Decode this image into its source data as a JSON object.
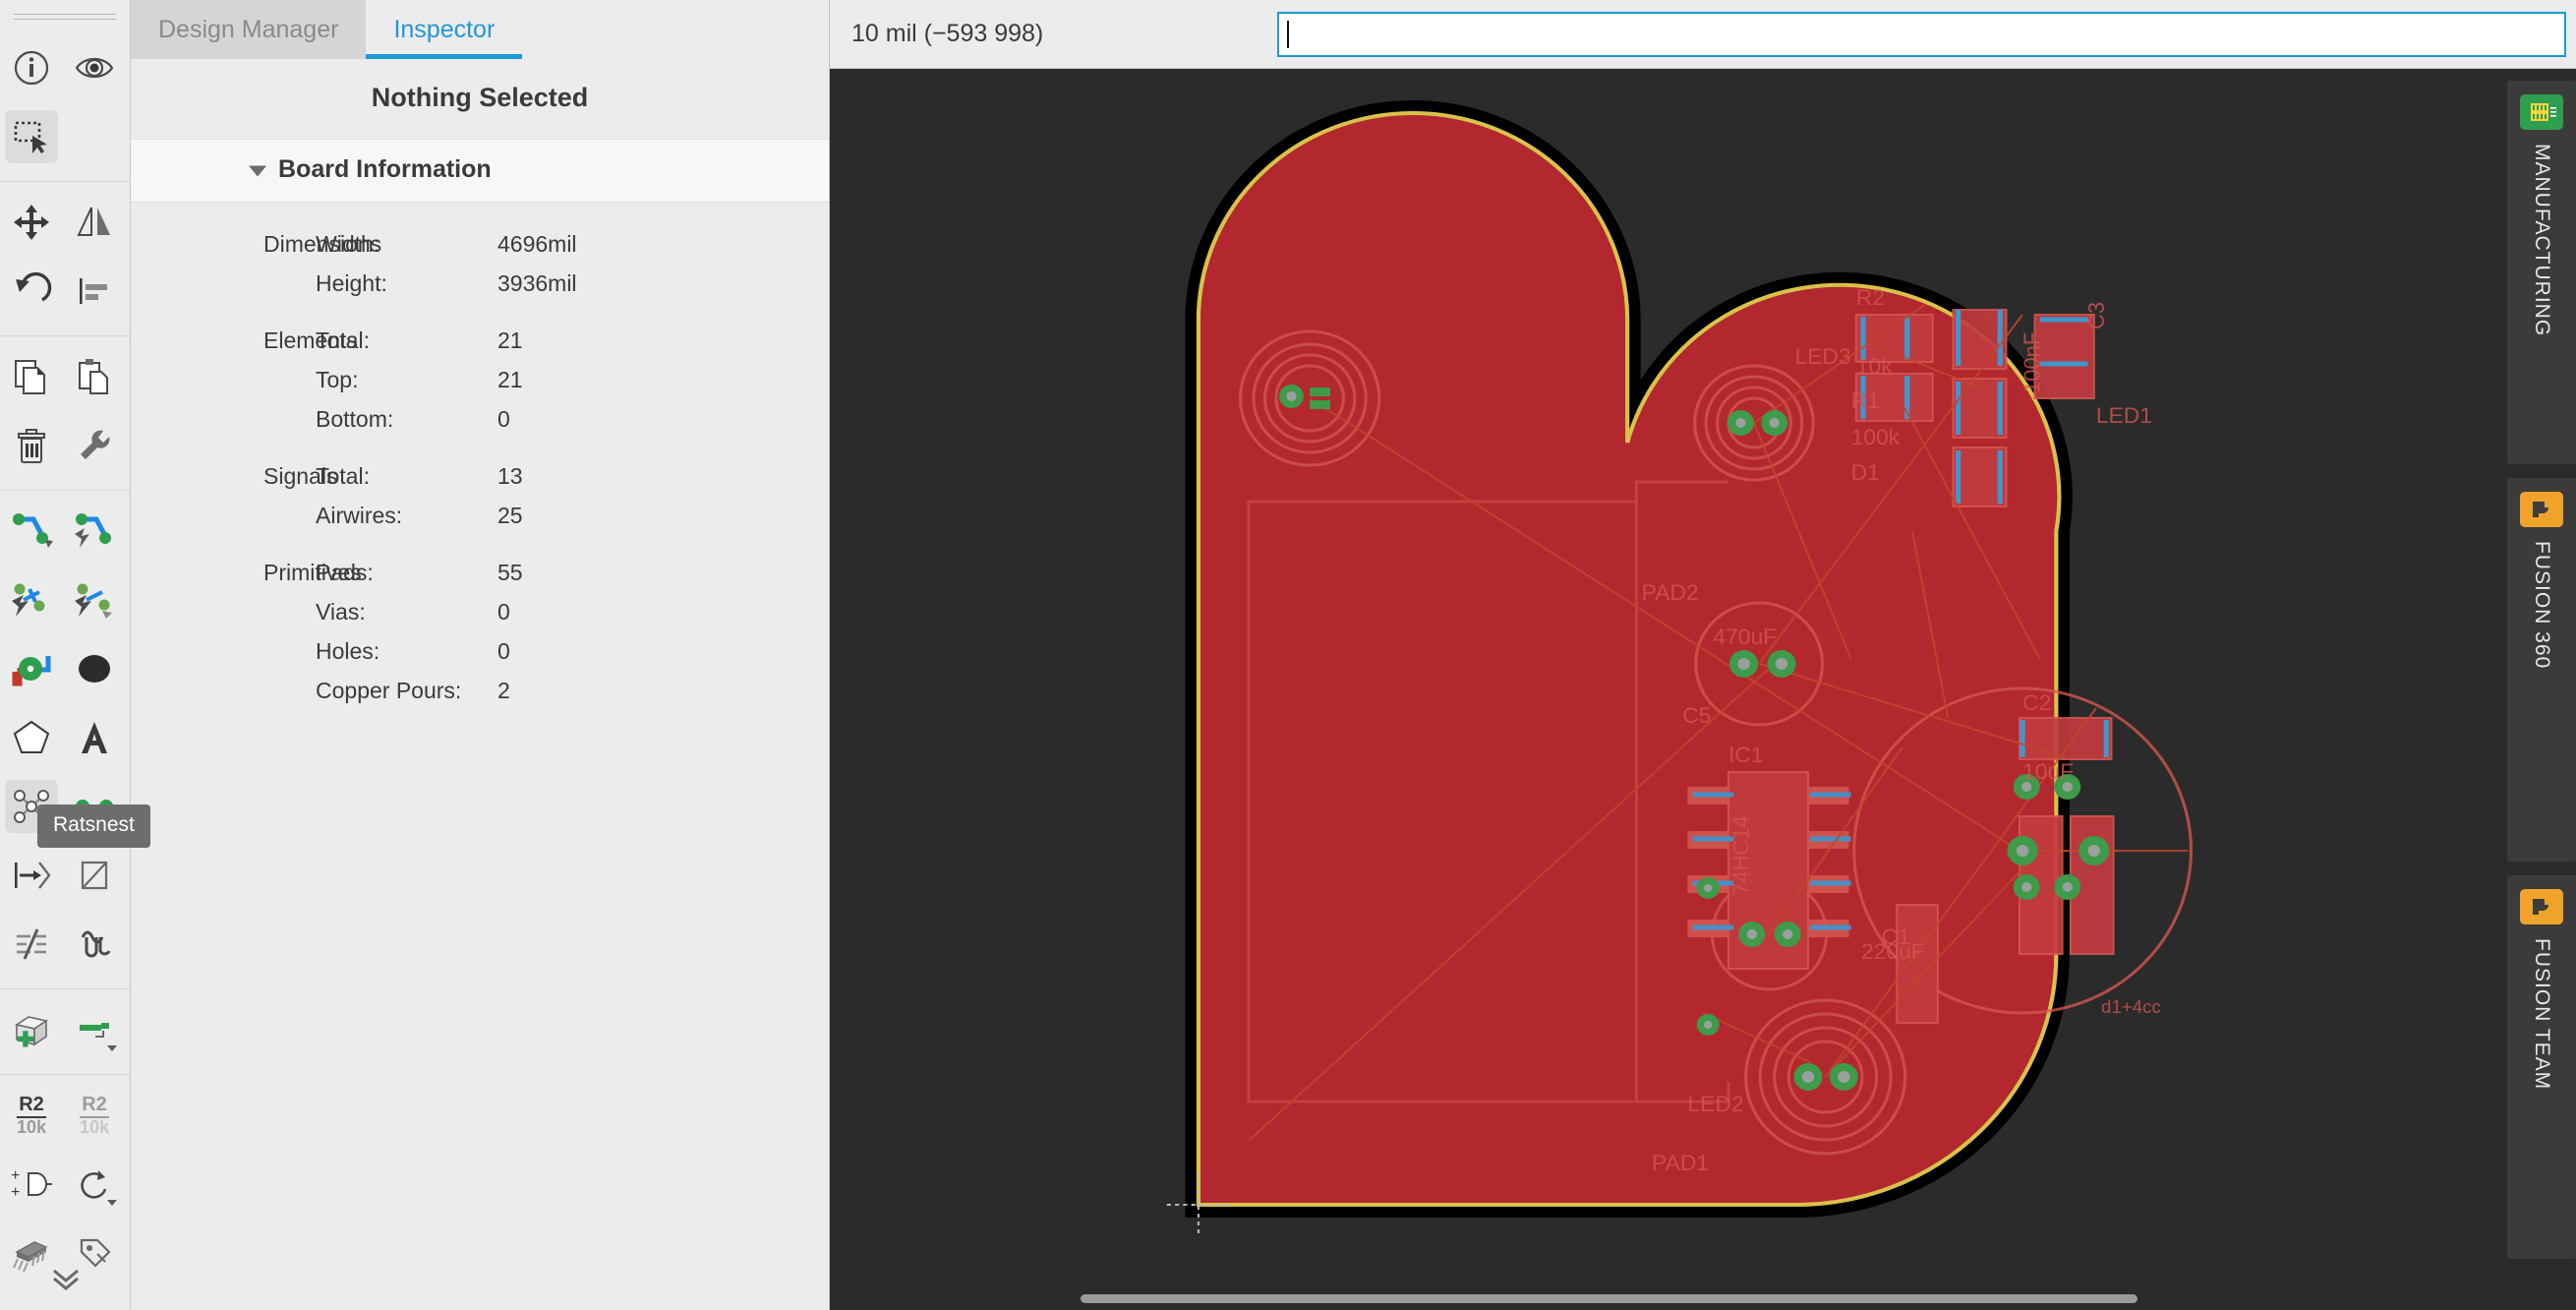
{
  "toolbar": {
    "groups": [
      {
        "items": [
          {
            "name": "info-icon",
            "label": "Info"
          },
          {
            "name": "visibility-eye-icon",
            "label": "Display Layers"
          }
        ]
      },
      {
        "items": [
          {
            "name": "select-marquee-icon",
            "label": "Select",
            "selected": true
          }
        ]
      },
      {
        "items": [
          {
            "name": "move-icon",
            "label": "Move"
          },
          {
            "name": "mirror-icon",
            "label": "Mirror"
          },
          {
            "name": "rotate-icon",
            "label": "Rotate"
          },
          {
            "name": "align-icon",
            "label": "Align"
          }
        ]
      },
      {
        "items": [
          {
            "name": "copy-icon",
            "label": "Copy"
          },
          {
            "name": "paste-icon",
            "label": "Paste"
          },
          {
            "name": "delete-trash-icon",
            "label": "Delete"
          },
          {
            "name": "wrench-icon",
            "label": "Tools"
          }
        ]
      },
      {
        "items": [
          {
            "name": "route-trace-icon",
            "label": "Route"
          },
          {
            "name": "route-autoroute-icon",
            "label": "Autoroute"
          },
          {
            "name": "ripup-icon",
            "label": "Rip Up"
          },
          {
            "name": "ripup-all-icon",
            "label": "Rip Up All"
          },
          {
            "name": "via-pad-icon",
            "label": "Via"
          },
          {
            "name": "polygon-fill-icon",
            "label": "Copper Pour"
          },
          {
            "name": "polygon-icon",
            "label": "Polygon"
          },
          {
            "name": "text-icon",
            "label": "Text"
          },
          {
            "name": "ratsnest-icon",
            "label": "Ratsnest",
            "selected": true
          },
          {
            "name": "net-icon",
            "label": "Net"
          },
          {
            "name": "dimension-arrow-icon",
            "label": "Dimension"
          },
          {
            "name": "measure-icon",
            "label": "Measure"
          },
          {
            "name": "layer-stack-icon",
            "label": "Layer Stack"
          },
          {
            "name": "design-rules-icon",
            "label": "Design Rules"
          }
        ]
      },
      {
        "items": [
          {
            "name": "add-part-icon",
            "label": "Add Part"
          },
          {
            "name": "add-part-alt-icon",
            "label": "Place Component"
          }
        ]
      },
      {
        "items": [
          {
            "name": "resistor-value-icon",
            "label": "R2",
            "sub": "10k"
          },
          {
            "name": "resistor-value-alt-icon",
            "label": "R2",
            "sub": "10k"
          },
          {
            "name": "gate-swap-icon",
            "label": "Swap Gate"
          },
          {
            "name": "replace-icon",
            "label": "Replace"
          },
          {
            "name": "package-icon",
            "label": "Package"
          },
          {
            "name": "attribute-tag-icon",
            "label": "Attributes"
          }
        ]
      }
    ],
    "tooltip": "Ratsnest",
    "expand_label": "More tools"
  },
  "inspector": {
    "tabs": [
      {
        "label": "Design Manager",
        "active": false
      },
      {
        "label": "Inspector",
        "active": true
      }
    ],
    "selection_status": "Nothing Selected",
    "section_title": "Board Information",
    "groups": [
      {
        "name": "Dimensions",
        "rows": [
          {
            "key": "Width:",
            "value": "4696mil"
          },
          {
            "key": "Height:",
            "value": "3936mil"
          }
        ]
      },
      {
        "name": "Elements",
        "rows": [
          {
            "key": "Total:",
            "value": "21"
          },
          {
            "key": "Top:",
            "value": "21"
          },
          {
            "key": "Bottom:",
            "value": "0"
          }
        ]
      },
      {
        "name": "Signals",
        "rows": [
          {
            "key": "Total:",
            "value": "13"
          },
          {
            "key": "Airwires:",
            "value": "25"
          }
        ]
      },
      {
        "name": "Primitives",
        "rows": [
          {
            "key": "Pads:",
            "value": "55"
          },
          {
            "key": "Vias:",
            "value": "0"
          },
          {
            "key": "Holes:",
            "value": "0"
          },
          {
            "key": "Copper Pours:",
            "value": "2"
          }
        ]
      }
    ]
  },
  "canvas": {
    "coordinate_readout": "10 mil (−593 998)",
    "command_line_value": "",
    "command_line_placeholder": "",
    "board": {
      "outline_color": "#d9c24a",
      "copper_color": "#b2282e",
      "background_color": "#2b2b2b",
      "silkscreen_color": "#d2564f",
      "pad_color": "#3f9a4a",
      "labels": [
        "R2",
        "10k",
        "R1",
        "100k",
        "D1",
        "LED3",
        "LED1",
        "100nF",
        "C3",
        "PAD2",
        "470uF",
        "C5",
        "IC1",
        "74HC14",
        "C2",
        "10uF",
        "C1",
        "220uF",
        "LED2",
        "PAD1"
      ]
    }
  },
  "right_dock": {
    "panels": [
      {
        "label": "MANUFACTURING",
        "icon": "pcb-chip-icon",
        "icon_color": "#2e9e4f"
      },
      {
        "label": "FUSION 360",
        "icon": "fusion-logo-icon",
        "icon_color": "#f0a32a"
      },
      {
        "label": "FUSION TEAM",
        "icon": "fusion-logo-icon",
        "icon_color": "#f0a32a"
      }
    ]
  },
  "colors": {
    "accent": "#1b9ad6",
    "panel_bg": "#ececec",
    "canvas_bg": "#2b2b2b",
    "board_red": "#b2282e",
    "board_outline": "#d9c24a"
  }
}
